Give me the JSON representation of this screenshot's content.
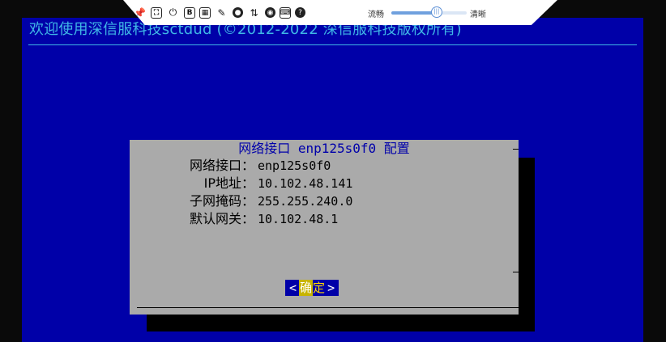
{
  "banner": {
    "text": "欢迎使用深信服科技sctdud (©2012-2022 深信服科技版权所有)"
  },
  "dialog": {
    "title": "网络接口 enp125s0f0 配置",
    "rows": [
      {
        "label": "网络接口：",
        "value": "enp125s0f0"
      },
      {
        "label": "IP地址：",
        "value": "10.102.48.141"
      },
      {
        "label": "子网掩码：",
        "value": "255.255.240.0"
      },
      {
        "label": "默认网关：",
        "value": "10.102.48.1"
      }
    ],
    "ok_button": {
      "left": "<",
      "hot": "确",
      "rest": "定",
      "right": ">"
    }
  },
  "toolbar": {
    "icons": [
      "pin-icon",
      "fullscreen-icon",
      "power-icon",
      "bold-b-icon",
      "screenshot-icon",
      "brush-icon",
      "record-icon",
      "file-transfer-icon",
      "video-icon",
      "keyboard-icon",
      "help-icon"
    ],
    "glyphs": [
      "📌",
      "⛶",
      "⏻",
      "B",
      "▦",
      "✎",
      "●",
      "⇅",
      "◉",
      "⌨",
      "?"
    ],
    "smooth_label": "流畅",
    "clear_label": "清晰",
    "quality_level": 0.6
  },
  "colors": {
    "screen_bg": "#0000a8",
    "dialog_bg": "#aaaaaa",
    "banner_text": "#3fb7e6",
    "title_text": "#0000aa",
    "hotkey": "#c8b400"
  }
}
